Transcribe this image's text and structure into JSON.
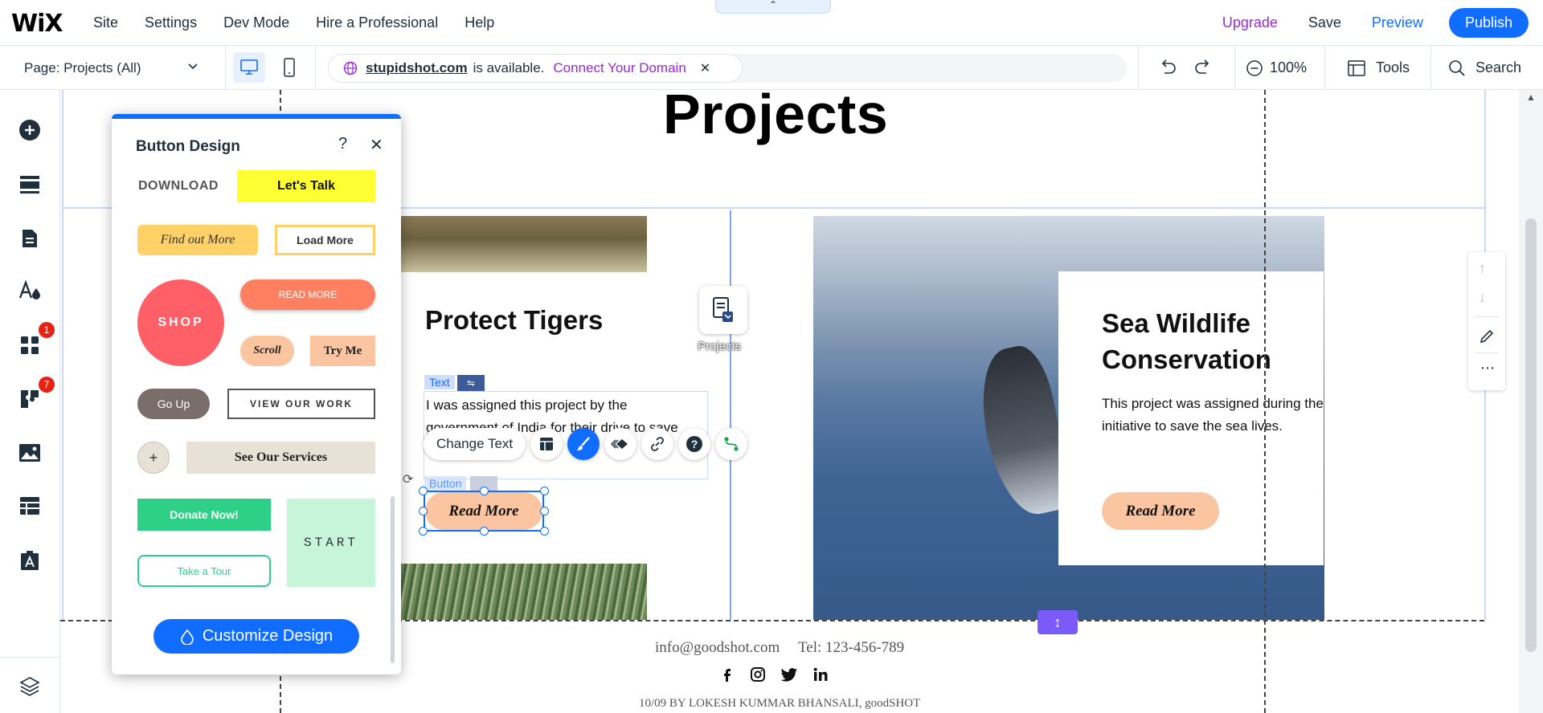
{
  "topbar": {
    "logo": "WiX",
    "menu": [
      "Site",
      "Settings",
      "Dev Mode",
      "Hire a Professional",
      "Help"
    ],
    "upgrade": "Upgrade",
    "save": "Save",
    "preview": "Preview",
    "publish": "Publish",
    "accent": "#116dff"
  },
  "subbar": {
    "page_label": "Page: Projects (All)",
    "domain": "stupidshot.com",
    "domain_status": "is available.",
    "connect_label": "Connect Your Domain",
    "zoom": "100%",
    "tools": "Tools",
    "search": "Search"
  },
  "leftrail": {
    "icons": [
      "add-icon",
      "sections-icon",
      "pages-icon",
      "design-icon",
      "apps-icon",
      "business-icon",
      "media-icon",
      "cms-icon",
      "portfolio-icon",
      "layers-icon"
    ],
    "apps_badge": "1",
    "business_badge": "7"
  },
  "canvas": {
    "page_title": "Projects",
    "tiger": {
      "title": "Protect Tigers",
      "text": "I was assigned this project by the government of India for their drive to save",
      "button": "Read More",
      "text_tag": "Text",
      "button_tag": "Button"
    },
    "toolbar": {
      "change_text": "Change Text"
    },
    "widget_label": "Projects",
    "sea": {
      "title": "Sea Wildlife Conservation",
      "text": "This project was assigned during the initiative to save the sea lives.",
      "button": "Read More"
    },
    "footer": {
      "email": "info@goodshot.com",
      "tel": "Tel: 123-456-789",
      "copyright": "10/09 BY LOKESH KUMMAR BHANSALI, goodSHOT",
      "social": [
        "facebook-icon",
        "instagram-icon",
        "twitter-icon",
        "linkedin-icon"
      ]
    }
  },
  "panel": {
    "title": "Button Design",
    "help": "?",
    "close": "✕",
    "buttons": {
      "download": "DOWNLOAD",
      "lets_talk": "Let's Talk",
      "find_out_more": "Find out More",
      "load_more": "Load More",
      "shop": "SHOP",
      "read_more": "READ MORE",
      "scroll": "Scroll",
      "try_me": "Try Me",
      "go_up": "Go Up",
      "view_our_work": "VIEW OUR WORK",
      "plus": "+",
      "see_our_services": "See Our Services",
      "donate_now": "Donate Now!",
      "take_a_tour": "Take a Tour",
      "start": "START"
    },
    "customize": "Customize Design"
  }
}
